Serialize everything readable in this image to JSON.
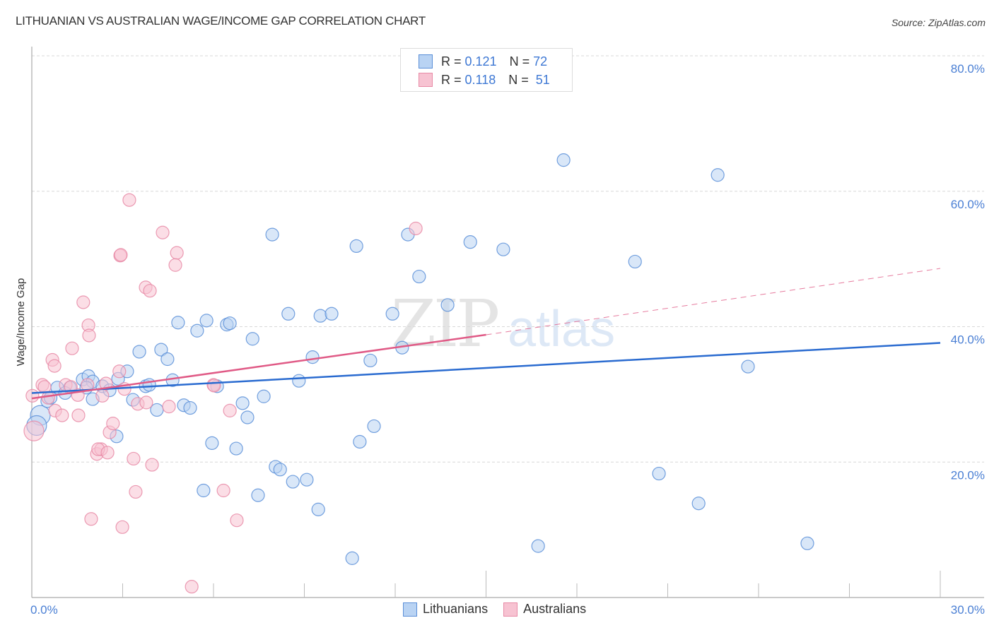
{
  "header": {
    "title": "LITHUANIAN VS AUSTRALIAN WAGE/INCOME GAP CORRELATION CHART",
    "source": "Source: ZipAtlas.com"
  },
  "watermark": {
    "zip": "ZIP",
    "atlas": "atlas"
  },
  "legend": {
    "rows": [
      {
        "r_label": "R = ",
        "r_value": "0.121",
        "n_label": "N = ",
        "n_value": "72"
      },
      {
        "r_label": "R = ",
        "r_value": "0.118",
        "n_label": "N = ",
        "n_value": "51"
      }
    ]
  },
  "bottom_legend": {
    "items": [
      {
        "label": "Lithuanians"
      },
      {
        "label": "Australians"
      }
    ]
  },
  "colors": {
    "blue_fill": "#b9d3f3",
    "blue_stroke": "#5b8fd8",
    "blue_line": "#2a6bd0",
    "pink_fill": "#f7c3d2",
    "pink_stroke": "#e88aa6",
    "pink_line": "#e05a86",
    "axis_text": "#4a7fd4",
    "grid": "#d8d8d8"
  },
  "chart_data": {
    "type": "scatter",
    "title": "LITHUANIAN VS AUSTRALIAN WAGE/INCOME GAP CORRELATION CHART",
    "xlabel": "",
    "ylabel": "Wage/Income Gap",
    "xlim": [
      0,
      30
    ],
    "ylim": [
      0,
      80
    ],
    "x_tick_labels": [
      "0.0%",
      "30.0%"
    ],
    "y_ticks": [
      20,
      40,
      60,
      80
    ],
    "y_tick_labels": [
      "20.0%",
      "40.0%",
      "60.0%",
      "80.0%"
    ],
    "grid": true,
    "legend_position": "top-center",
    "series": [
      {
        "name": "Lithuanians",
        "R": 0.121,
        "N": 72,
        "trend": {
          "x": [
            0,
            30
          ],
          "y": [
            30.2,
            37.6
          ],
          "style": "solid"
        },
        "points": [
          [
            0.28,
            26.9,
            2
          ],
          [
            0.16,
            25.4,
            2
          ],
          [
            0.51,
            29.0
          ],
          [
            0.84,
            31.0
          ],
          [
            1.26,
            31.0
          ],
          [
            1.68,
            32.2
          ],
          [
            1.87,
            32.7
          ],
          [
            2.01,
            31.9
          ],
          [
            1.8,
            31.0
          ],
          [
            2.33,
            31.2
          ],
          [
            2.57,
            30.6
          ],
          [
            2.01,
            29.3
          ],
          [
            2.85,
            32.3
          ],
          [
            2.8,
            23.8
          ],
          [
            3.15,
            33.4
          ],
          [
            3.34,
            29.2
          ],
          [
            3.55,
            36.3
          ],
          [
            3.76,
            31.2
          ],
          [
            3.88,
            31.4
          ],
          [
            4.27,
            36.6
          ],
          [
            4.13,
            27.7
          ],
          [
            4.48,
            35.2
          ],
          [
            4.65,
            32.1
          ],
          [
            4.83,
            40.6
          ],
          [
            5.02,
            28.4
          ],
          [
            5.23,
            28.0
          ],
          [
            5.46,
            39.4
          ],
          [
            5.77,
            40.9
          ],
          [
            5.67,
            15.8
          ],
          [
            5.95,
            22.8
          ],
          [
            6.12,
            31.2
          ],
          [
            6.44,
            40.3
          ],
          [
            6.54,
            40.5
          ],
          [
            6.75,
            22.0
          ],
          [
            6.96,
            28.7
          ],
          [
            7.12,
            26.6
          ],
          [
            7.29,
            38.2
          ],
          [
            7.47,
            15.1
          ],
          [
            7.66,
            29.7
          ],
          [
            7.94,
            53.6
          ],
          [
            8.05,
            19.3
          ],
          [
            8.2,
            18.9
          ],
          [
            8.62,
            17.1
          ],
          [
            8.47,
            41.9
          ],
          [
            8.82,
            32.0
          ],
          [
            9.08,
            17.4
          ],
          [
            9.27,
            35.5
          ],
          [
            9.46,
            13.0
          ],
          [
            9.53,
            41.6
          ],
          [
            9.9,
            41.9
          ],
          [
            10.58,
            5.8
          ],
          [
            10.72,
            51.9
          ],
          [
            10.83,
            23.0
          ],
          [
            11.18,
            35.0
          ],
          [
            11.3,
            25.3
          ],
          [
            11.91,
            41.9
          ],
          [
            12.23,
            36.9
          ],
          [
            12.42,
            53.6
          ],
          [
            12.79,
            47.4
          ],
          [
            13.73,
            43.2
          ],
          [
            14.48,
            52.5
          ],
          [
            15.57,
            51.4
          ],
          [
            16.72,
            7.6
          ],
          [
            17.56,
            64.6
          ],
          [
            19.92,
            49.6
          ],
          [
            20.71,
            18.3
          ],
          [
            22.02,
            13.9
          ],
          [
            22.65,
            62.4
          ],
          [
            23.65,
            34.1
          ],
          [
            25.61,
            8.0
          ],
          [
            0.62,
            29.5
          ],
          [
            1.1,
            30.2
          ]
        ]
      },
      {
        "name": "Australians",
        "R": 0.118,
        "N": 51,
        "trend": {
          "x": [
            0,
            15
          ],
          "y": [
            29.4,
            38.8
          ],
          "style": "solid",
          "extended": {
            "x": [
              15,
              30
            ],
            "y": [
              38.8,
              48.6
            ],
            "style": "dashed"
          }
        },
        "points": [
          [
            3.22,
            58.7
          ],
          [
            4.32,
            53.9
          ],
          [
            2.92,
            50.5
          ],
          [
            2.94,
            50.6
          ],
          [
            4.79,
            50.9
          ],
          [
            4.74,
            49.1
          ],
          [
            3.76,
            45.8
          ],
          [
            3.9,
            45.3
          ],
          [
            1.7,
            43.6
          ],
          [
            1.87,
            40.2
          ],
          [
            1.89,
            38.7
          ],
          [
            1.33,
            36.8
          ],
          [
            0.68,
            35.1
          ],
          [
            0.75,
            34.2
          ],
          [
            1.12,
            31.4
          ],
          [
            0.35,
            31.4
          ],
          [
            0.42,
            31.1
          ],
          [
            0.02,
            29.8
          ],
          [
            0.07,
            24.6,
            2
          ],
          [
            0.54,
            29.5
          ],
          [
            0.77,
            27.6
          ],
          [
            1.0,
            26.9
          ],
          [
            1.54,
            26.9
          ],
          [
            1.52,
            29.9
          ],
          [
            1.84,
            31.4
          ],
          [
            2.33,
            29.8
          ],
          [
            2.45,
            31.6
          ],
          [
            2.89,
            33.4
          ],
          [
            3.06,
            30.8
          ],
          [
            3.5,
            28.6
          ],
          [
            3.78,
            28.8
          ],
          [
            2.57,
            24.4
          ],
          [
            2.68,
            25.7
          ],
          [
            2.15,
            21.2
          ],
          [
            2.29,
            21.9
          ],
          [
            2.19,
            21.9
          ],
          [
            2.5,
            21.4
          ],
          [
            3.36,
            20.5
          ],
          [
            3.43,
            15.6
          ],
          [
            3.97,
            19.6
          ],
          [
            4.53,
            28.2
          ],
          [
            6.0,
            31.4
          ],
          [
            6.54,
            27.6
          ],
          [
            6.33,
            15.8
          ],
          [
            6.77,
            11.4
          ],
          [
            1.96,
            11.6
          ],
          [
            2.99,
            10.4
          ],
          [
            5.28,
            1.6
          ],
          [
            12.68,
            54.5
          ],
          [
            6.02,
            31.3
          ],
          [
            1.29,
            31.1
          ]
        ]
      }
    ]
  }
}
